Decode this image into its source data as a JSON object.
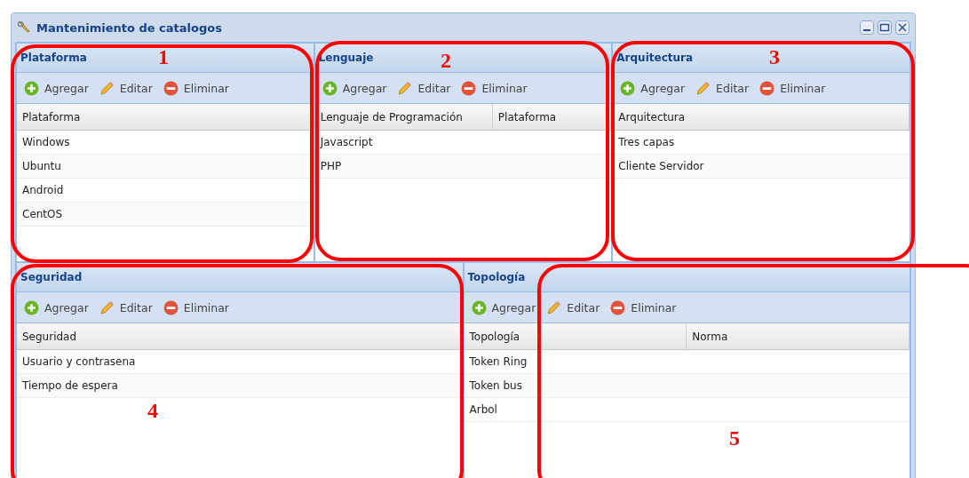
{
  "window": {
    "title": "Mantenimiento de catalogos"
  },
  "panels": [
    {
      "title": "Plataforma",
      "toolbar": [
        {
          "kind": "add",
          "label": "Agregar"
        },
        {
          "kind": "edit",
          "label": "Editar"
        },
        {
          "kind": "delete",
          "label": "Eliminar"
        }
      ],
      "columns": [
        "Plataforma"
      ],
      "rows": [
        [
          "Windows"
        ],
        [
          "Ubuntu"
        ],
        [
          "Android"
        ],
        [
          "CentOS"
        ]
      ]
    },
    {
      "title": "Lenguaje",
      "toolbar": [
        {
          "kind": "add",
          "label": "Agregar"
        },
        {
          "kind": "edit",
          "label": "Editar"
        },
        {
          "kind": "delete",
          "label": "Eliminar"
        }
      ],
      "columns": [
        "Lenguaje de Programación",
        "Plataforma"
      ],
      "rows": [
        [
          "Javascript"
        ],
        [
          "PHP"
        ]
      ]
    },
    {
      "title": "Arquitectura",
      "toolbar": [
        {
          "kind": "add",
          "label": "Agregar"
        },
        {
          "kind": "edit",
          "label": "Editar"
        },
        {
          "kind": "delete",
          "label": "Eliminar"
        }
      ],
      "columns": [
        "Arquitectura"
      ],
      "rows": [
        [
          "Tres capas"
        ],
        [
          "Cliente Servidor"
        ]
      ]
    },
    {
      "title": "Seguridad",
      "toolbar": [
        {
          "kind": "add",
          "label": "Agregar"
        },
        {
          "kind": "edit",
          "label": "Editar"
        },
        {
          "kind": "delete",
          "label": "Eliminar"
        }
      ],
      "columns": [
        "Seguridad"
      ],
      "rows": [
        [
          "Usuario y contrasena"
        ],
        [
          "Tiempo de espera"
        ]
      ]
    },
    {
      "title": "Topología",
      "toolbar": [
        {
          "kind": "add",
          "label": "Agregar"
        },
        {
          "kind": "edit",
          "label": "Editar"
        },
        {
          "kind": "delete",
          "label": "Eliminar"
        }
      ],
      "columns": [
        "Topología",
        "Norma"
      ],
      "rows": [
        [
          "Token Ring"
        ],
        [
          "Token bus"
        ],
        [
          "Arbol"
        ]
      ]
    }
  ],
  "annotations": [
    "1",
    "2",
    "3",
    "4",
    "5"
  ]
}
